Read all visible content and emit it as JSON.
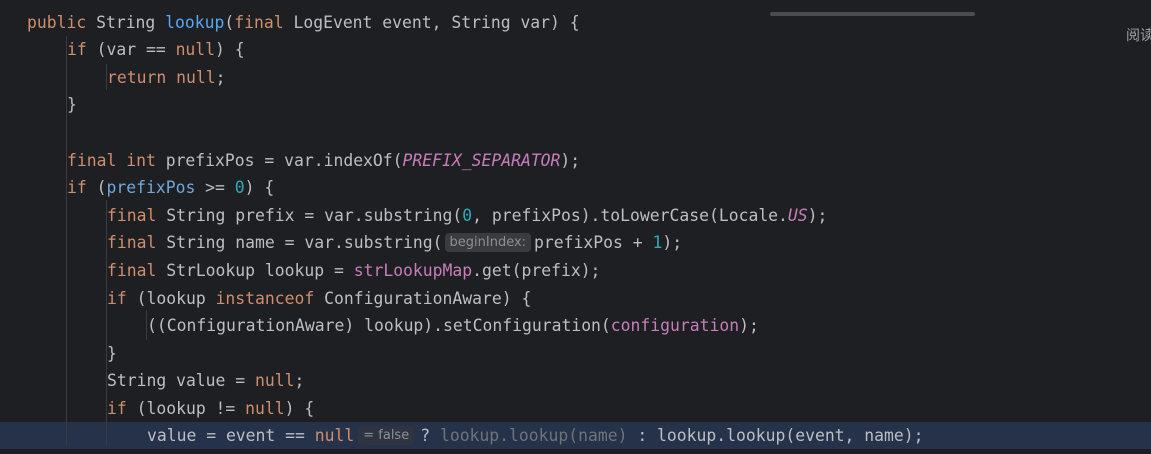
{
  "editor": {
    "side_label": "阅读",
    "hints": {
      "begin_index": "beginIndex:",
      "inline_value": "= false"
    },
    "lines": {
      "l1": {
        "t1": "public",
        "t2": " String ",
        "t3": "lookup",
        "t4": "(",
        "t5": "final",
        "t6": " LogEvent event, String var) {"
      },
      "l2": {
        "t1": "if",
        "t2": " (var == ",
        "t3": "null",
        "t4": ") {"
      },
      "l3": {
        "t1": "return",
        "t2": " ",
        "t3": "null",
        "t4": ";"
      },
      "l4": {
        "t1": "}"
      },
      "l5": {
        "t1": "final",
        "t2": " ",
        "t3": "int",
        "t4": " prefixPos = var.indexOf(",
        "t5": "PREFIX_SEPARATOR",
        "t6": ");"
      },
      "l6": {
        "t1": "if",
        "t2": " (",
        "t3": "prefixPos",
        "t4": " >= ",
        "t5": "0",
        "t6": ") {"
      },
      "l7": {
        "t1": "final",
        "t2": " String prefix = var.substring(",
        "t3": "0",
        "t4": ", prefixPos).toLowerCase(Locale.",
        "t5": "US",
        "t6": ");"
      },
      "l8": {
        "t1": "final",
        "t2": " String name = var.substring(",
        "t3": "prefixPos + ",
        "t4": "1",
        "t5": ");"
      },
      "l9": {
        "t1": "final",
        "t2": " StrLookup lookup = ",
        "t3": "strLookupMap",
        "t4": ".get(prefix);"
      },
      "l10": {
        "t1": "if",
        "t2": " (lookup ",
        "t3": "instanceof",
        "t4": " ConfigurationAware) {"
      },
      "l11": {
        "t1": "((ConfigurationAware) lookup).setConfiguration(",
        "t2": "configuration",
        "t3": ");"
      },
      "l12": {
        "t1": "}"
      },
      "l13": {
        "t1": "String value = ",
        "t2": "null",
        "t3": ";"
      },
      "l14": {
        "t1": "if",
        "t2": " (lookup != ",
        "t3": "null",
        "t4": ") {"
      },
      "l15": {
        "t1": "value = event == ",
        "t2": "null",
        "t3": "? ",
        "t4": "lookup.lookup(name)",
        "t5": " : lookup.lookup(event, name);"
      }
    }
  }
}
